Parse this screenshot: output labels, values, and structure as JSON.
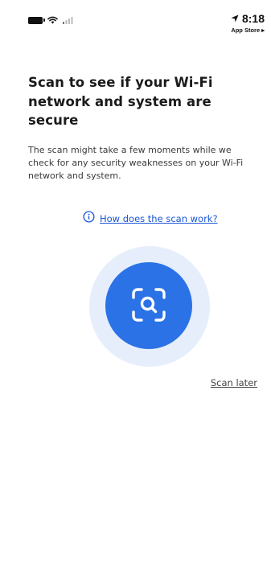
{
  "status_bar": {
    "time": "8:18",
    "back_app": "App Store ▸",
    "icons": [
      "battery-icon",
      "wifi-icon",
      "signal-icon",
      "location-arrow-icon"
    ]
  },
  "main": {
    "title": "Scan to see if your Wi-Fi network and system are secure",
    "description": "The scan might take a few moments while we check for any security weaknesses on your Wi-Fi network and system.",
    "help_link": "How does the scan work?",
    "scan_button_icon": "scan-search-icon",
    "scan_later": "Scan later"
  },
  "colors": {
    "accent": "#2a72e6",
    "halo": "#e6eefc",
    "link": "#1a56d6",
    "text": "#1b1b1b"
  }
}
